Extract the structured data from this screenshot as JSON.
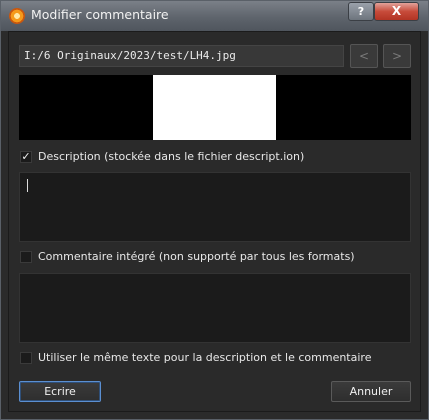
{
  "window": {
    "title": "Modifier commentaire",
    "help_label": "?",
    "close_label": "X"
  },
  "file": {
    "path": "I:/6 Originaux/2023/test/LH4.jpg",
    "prev_label": "<",
    "next_label": ">"
  },
  "description": {
    "label": "Description (stockée dans le fichier descript.ion)",
    "checked": true,
    "check_mark": "✓",
    "value": ""
  },
  "comment": {
    "label": "Commentaire intégré (non supporté par tous les formats)",
    "checked": false,
    "value": ""
  },
  "same_text": {
    "label": "Utiliser le même texte pour la description et le commentaire",
    "checked": false
  },
  "buttons": {
    "write": "Ecrire",
    "cancel": "Annuler"
  }
}
